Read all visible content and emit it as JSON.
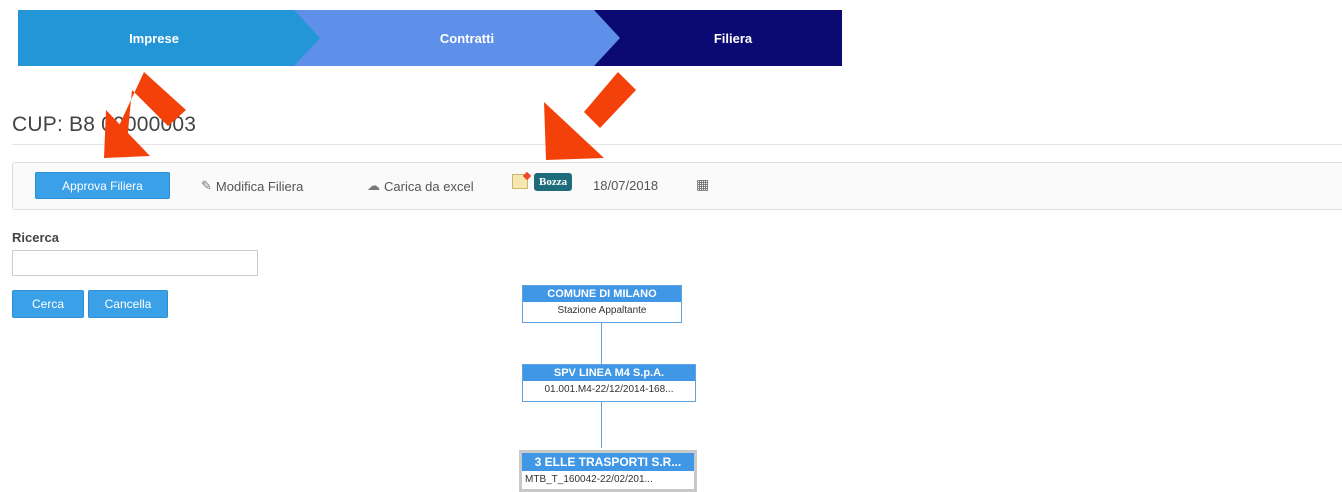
{
  "wizard": {
    "steps": [
      {
        "label": "Imprese"
      },
      {
        "label": "Contratti"
      },
      {
        "label": "Filiera"
      }
    ]
  },
  "page": {
    "title": "CUP: B8 00000003"
  },
  "toolbar": {
    "approve_label": "Approva Filiera",
    "edit_label": "Modifica Filiera",
    "excel_label": "Carica da excel",
    "status_badge": "Bozza",
    "date": "18/07/2018"
  },
  "search": {
    "label": "Ricerca",
    "value": "",
    "placeholder": "",
    "search_button": "Cerca",
    "clear_button": "Cancella"
  },
  "tree": {
    "nodes": [
      {
        "name": "COMUNE DI MILANO",
        "detail": "Stazione Appaltante"
      },
      {
        "name": "SPV LINEA M4 S.p.A.",
        "detail": "01.001.M4-22/12/2014-168..."
      },
      {
        "name": "3 ELLE TRASPORTI S.R...",
        "detail": "MTB_T_160042-22/02/201..."
      }
    ]
  },
  "colors": {
    "step1": "#2396d8",
    "step2": "#5e90e9",
    "step3": "#0a0a72",
    "primary_button": "#3aa0e8",
    "badge": "#1e6b7b",
    "arrow": "#f4410a"
  }
}
